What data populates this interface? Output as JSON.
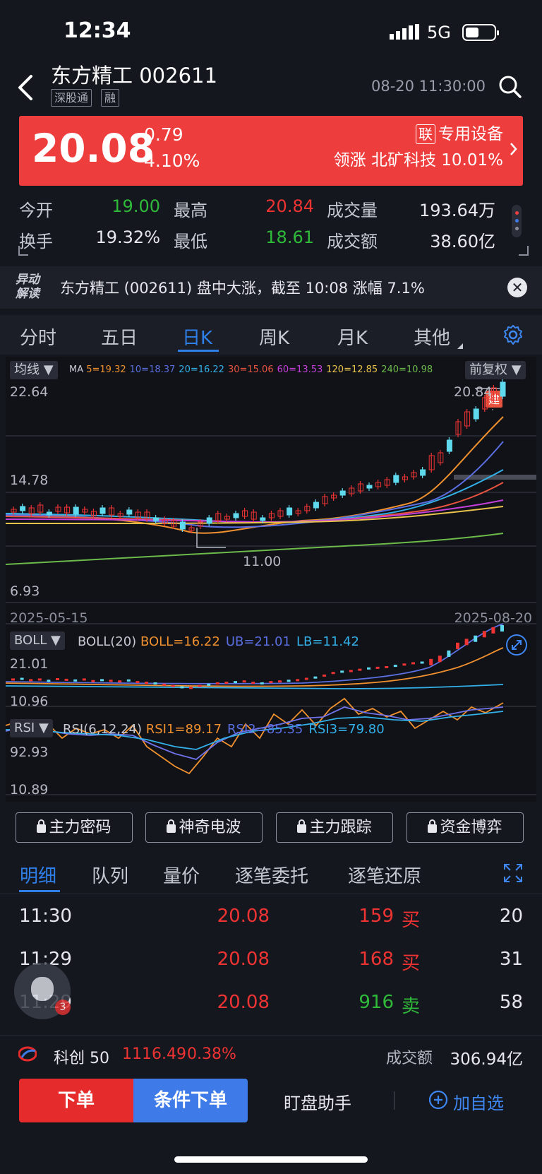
{
  "status": {
    "time": "12:34",
    "network": "5G"
  },
  "header": {
    "title": "东方精工 002611",
    "tags": [
      "深股通",
      "融"
    ],
    "timestamp": "08-20 11:30:00"
  },
  "quote": {
    "price": "20.08",
    "change": "0.79",
    "change_pct": "4.10%",
    "sector_tag": "联",
    "sector": "专用设备",
    "leader_label": "领涨",
    "leader": "北矿科技 10.01%",
    "colors": {
      "up": "#ee3333",
      "down": "#2fba3a",
      "card": "#ee3d3d"
    }
  },
  "stats": [
    {
      "label": "今开",
      "value": "19.00",
      "tone": "green"
    },
    {
      "label": "最高",
      "value": "20.84",
      "tone": "red"
    },
    {
      "label": "成交量",
      "value": "193.64万",
      "tone": "white"
    },
    {
      "label": "换手",
      "value": "19.32%",
      "tone": "white"
    },
    {
      "label": "最低",
      "value": "18.61",
      "tone": "green"
    },
    {
      "label": "成交额",
      "value": "38.60亿",
      "tone": "white"
    }
  ],
  "alert": {
    "badge_line1": "异动",
    "badge_line2": "解读",
    "text": "东方精工 (002611) 盘中大涨，截至 10:08 涨幅 7.1%"
  },
  "tabs": [
    "分时",
    "五日",
    "日K",
    "周K",
    "月K",
    "其他"
  ],
  "active_tab": "日K",
  "chart": {
    "indicator_select": "均线",
    "adjust_select": "前复权",
    "ma_prefix": "MA",
    "ma": [
      {
        "text": "5=19.32",
        "color": "#f0902e"
      },
      {
        "text": "10=18.37",
        "color": "#5a6ee0"
      },
      {
        "text": "20=16.22",
        "color": "#33b0e8"
      },
      {
        "text": "30=15.06",
        "color": "#e8533f"
      },
      {
        "text": "60=13.53",
        "color": "#c43fd8"
      },
      {
        "text": "120=12.85",
        "color": "#e8c24a"
      },
      {
        "text": "240=10.98",
        "color": "#6cbb4a"
      }
    ],
    "y_top": "22.64",
    "y_mid": "14.78",
    "y_bottom": "6.93",
    "high_label": "20.84",
    "low_label": "11.00",
    "signal_tag": "建",
    "date_start": "2025-05-15",
    "date_end": "2025-08-20",
    "boll_select": "BOLL",
    "boll_name": "BOLL(20)",
    "boll_vals": [
      {
        "text": "BOLL=16.22",
        "color": "#f0902e"
      },
      {
        "text": "UB=21.01",
        "color": "#5a6ee0"
      },
      {
        "text": "LB=11.42",
        "color": "#33b0e8"
      }
    ],
    "boll_top": "21.01",
    "boll_bottom": "10.96",
    "rsi_select": "RSI",
    "rsi_name": "RSI(6,12,24)",
    "rsi_vals": [
      {
        "text": "RSI1=89.17",
        "color": "#f0902e"
      },
      {
        "text": "RSI2=85.35",
        "color": "#5a6ee0"
      },
      {
        "text": "RSI3=79.80",
        "color": "#33b0e8"
      }
    ],
    "rsi_top": "92.93",
    "rsi_bottom": "10.89"
  },
  "locked_tools": [
    "主力密码",
    "神奇电波",
    "主力跟踪",
    "资金博弈"
  ],
  "detail_tabs": [
    "明细",
    "队列",
    "量价",
    "逐笔委托",
    "逐笔还原"
  ],
  "trades": [
    {
      "time": "11:30",
      "price": "20.08",
      "vol": "159",
      "side": "买",
      "count": "20",
      "tone": "red"
    },
    {
      "time": "11:29",
      "price": "20.08",
      "vol": "168",
      "side": "买",
      "count": "31",
      "tone": "red"
    },
    {
      "time": "11:29",
      "price": "20.08",
      "vol": "916",
      "side": "卖",
      "count": "58",
      "tone": "green"
    }
  ],
  "assistant_badge": "3",
  "index_strip": {
    "name": "科创 50",
    "value": "1116.49",
    "pct": "0.38%",
    "turnover_label": "成交额",
    "turnover": "306.94亿"
  },
  "bottom": {
    "order": "下单",
    "conditional": "条件下单",
    "helper": "盯盘助手",
    "watch": "加自选"
  }
}
